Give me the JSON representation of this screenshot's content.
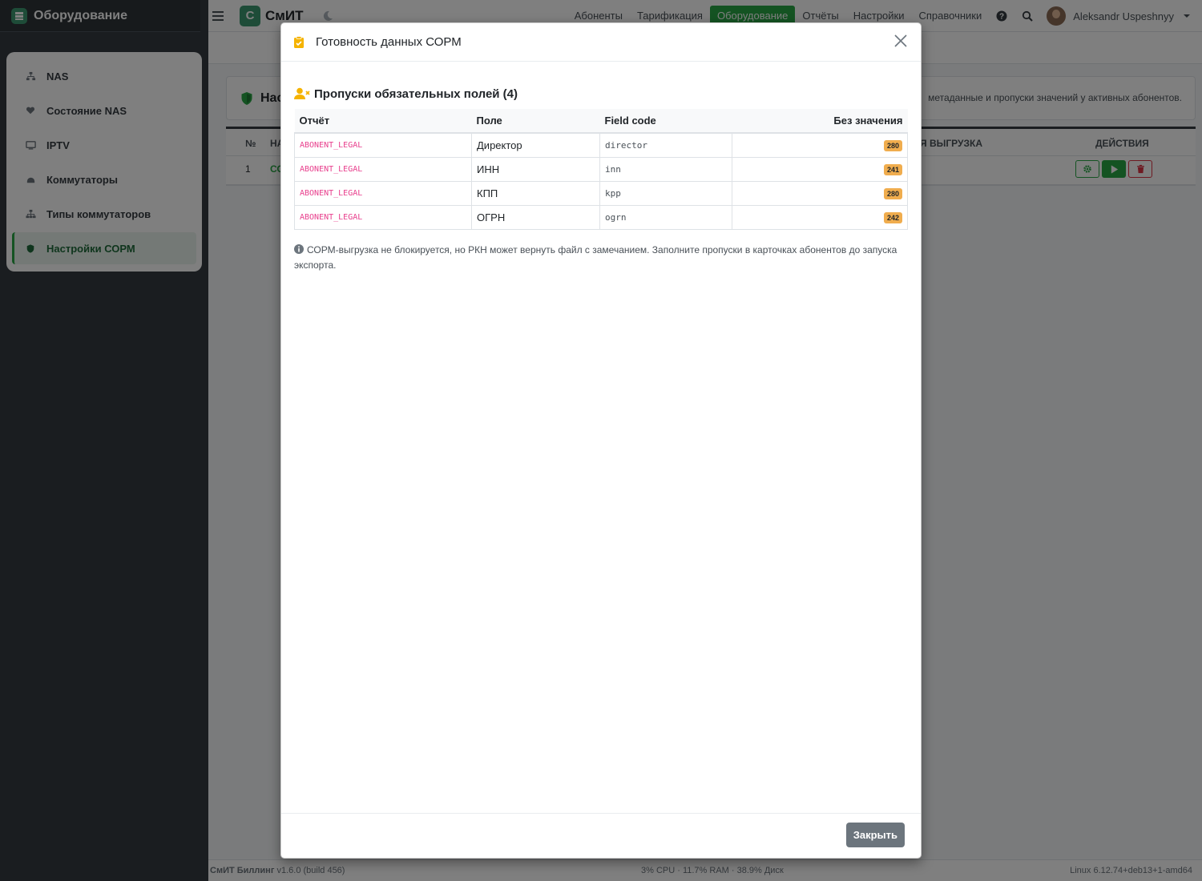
{
  "brand": {
    "title": "Оборудование"
  },
  "sidebar": {
    "items": [
      {
        "label": "NAS",
        "icon": "network-icon"
      },
      {
        "label": "Состояние NAS",
        "icon": "heart-icon"
      },
      {
        "label": "IPTV",
        "icon": "tv-icon"
      },
      {
        "label": "Коммутаторы",
        "icon": "hdd-icon"
      },
      {
        "label": "Типы коммутаторов",
        "icon": "sitemap-icon"
      },
      {
        "label": "Настройки СОРМ",
        "icon": "shield-icon",
        "active": true
      }
    ]
  },
  "navbar": {
    "logo_letter": "С",
    "logo_text": "СмИТ",
    "links": [
      "Абоненты",
      "Тарификация",
      "Оборудование",
      "Отчёты",
      "Настройки",
      "Справочники"
    ],
    "active_link": "Оборудование",
    "user_name": "Aleksandr Uspeshnyy"
  },
  "background_page": {
    "card_title": "Нас",
    "card_desc": "метаданные и пропуски значений у активных абонентов.",
    "table_headers": {
      "num": "№",
      "name": "НА",
      "export": "Я ВЫГРУЗКА",
      "actions": "ДЕЙСТВИЯ"
    },
    "row": {
      "num": "1",
      "name": "СО"
    }
  },
  "modal": {
    "title": "Готовность данных СОРМ",
    "section_title": "Пропуски обязательных полей (4)",
    "columns": [
      "Отчёт",
      "Поле",
      "Field code",
      "Без значения"
    ],
    "rows": [
      {
        "report": "ABONENT_LEGAL",
        "field": "Директор",
        "code": "director",
        "missing": "280"
      },
      {
        "report": "ABONENT_LEGAL",
        "field": "ИНН",
        "code": "inn",
        "missing": "241"
      },
      {
        "report": "ABONENT_LEGAL",
        "field": "КПП",
        "code": "kpp",
        "missing": "280"
      },
      {
        "report": "ABONENT_LEGAL",
        "field": "ОГРН",
        "code": "ogrn",
        "missing": "242"
      }
    ],
    "note": "СОРМ-выгрузка не блокируется, но РКН может вернуть файл с замечанием. Заполните пропуски в карточках абонентов до запуска экспорта.",
    "close_label": "Закрыть"
  },
  "footer": {
    "app": "СмИТ Биллинг",
    "version": "v1.6.0 (build 456)",
    "stats": "3% CPU · 11.7% RAM · 38.9% Диск",
    "os": "Linux 6.12.74+deb13+1-amd64"
  },
  "colors": {
    "accent": "#28a745",
    "badge": "#f0ad4e",
    "code": "#e83e8c"
  }
}
